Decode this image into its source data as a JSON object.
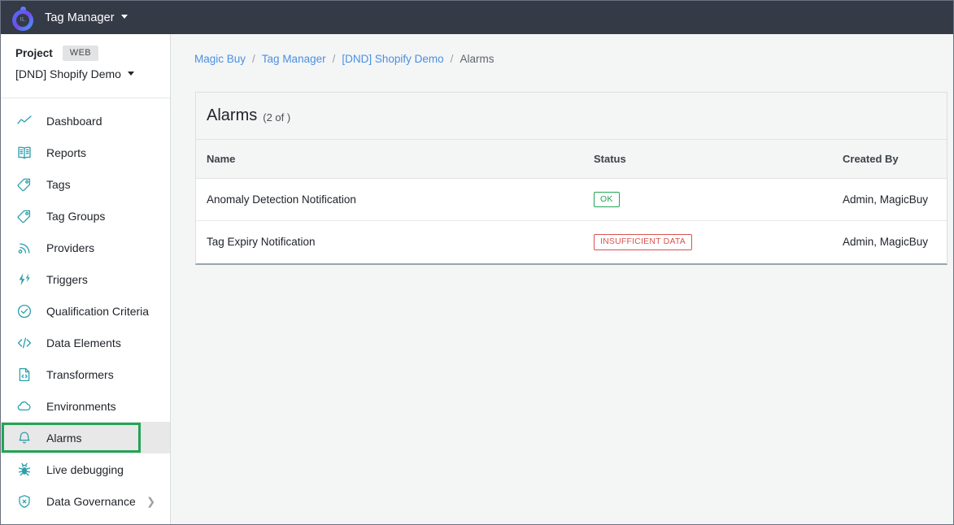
{
  "topbar": {
    "logo_initials": "IL",
    "title": "Tag Manager"
  },
  "sidebar": {
    "project_label": "Project",
    "project_type_chip": "WEB",
    "project_name": "[DND] Shopify Demo",
    "items": [
      {
        "label": "Dashboard",
        "icon": "line-chart-icon",
        "selected": false,
        "has_chevron": false
      },
      {
        "label": "Reports",
        "icon": "book-icon",
        "selected": false,
        "has_chevron": false
      },
      {
        "label": "Tags",
        "icon": "tag-icon",
        "selected": false,
        "has_chevron": false
      },
      {
        "label": "Tag Groups",
        "icon": "tag-icon",
        "selected": false,
        "has_chevron": false
      },
      {
        "label": "Providers",
        "icon": "rss-icon",
        "selected": false,
        "has_chevron": false
      },
      {
        "label": "Triggers",
        "icon": "lightning-bolt-icon",
        "selected": false,
        "has_chevron": false
      },
      {
        "label": "Qualification Criteria",
        "icon": "check-circle-icon",
        "selected": false,
        "has_chevron": false
      },
      {
        "label": "Data Elements",
        "icon": "code-brackets-icon",
        "selected": false,
        "has_chevron": false
      },
      {
        "label": "Transformers",
        "icon": "file-code-icon",
        "selected": false,
        "has_chevron": false
      },
      {
        "label": "Environments",
        "icon": "cloud-icon",
        "selected": false,
        "has_chevron": false
      },
      {
        "label": "Alarms",
        "icon": "bell-icon",
        "selected": true,
        "has_chevron": false
      },
      {
        "label": "Live debugging",
        "icon": "bug-icon",
        "selected": false,
        "has_chevron": false
      },
      {
        "label": "Data Governance",
        "icon": "shield-x-icon",
        "selected": false,
        "has_chevron": true
      }
    ]
  },
  "breadcrumb": {
    "items": [
      {
        "label": "Magic Buy",
        "link": true
      },
      {
        "label": "Tag Manager",
        "link": true
      },
      {
        "label": "[DND] Shopify Demo",
        "link": true
      },
      {
        "label": "Alarms",
        "link": false
      }
    ],
    "separator": "/"
  },
  "main": {
    "card": {
      "title": "Alarms",
      "count_text": "(2 of )",
      "columns": [
        "Name",
        "Status",
        "Created By"
      ],
      "rows": [
        {
          "name": "Anomaly Detection Notification",
          "status": "OK",
          "status_kind": "ok",
          "created_by": "Admin, MagicBuy"
        },
        {
          "name": "Tag Expiry Notification",
          "status": "INSUFFICIENT DATA",
          "status_kind": "insufficient",
          "created_by": "Admin, MagicBuy"
        }
      ]
    }
  },
  "colors": {
    "topbar_bg": "#343a46",
    "icon_teal": "#2d9fab",
    "link_blue": "#4a90e2",
    "selection_green": "#23a455",
    "status_ok": "#23a455",
    "status_insufficient": "#d9534f",
    "page_bg": "#f4f5f5"
  }
}
